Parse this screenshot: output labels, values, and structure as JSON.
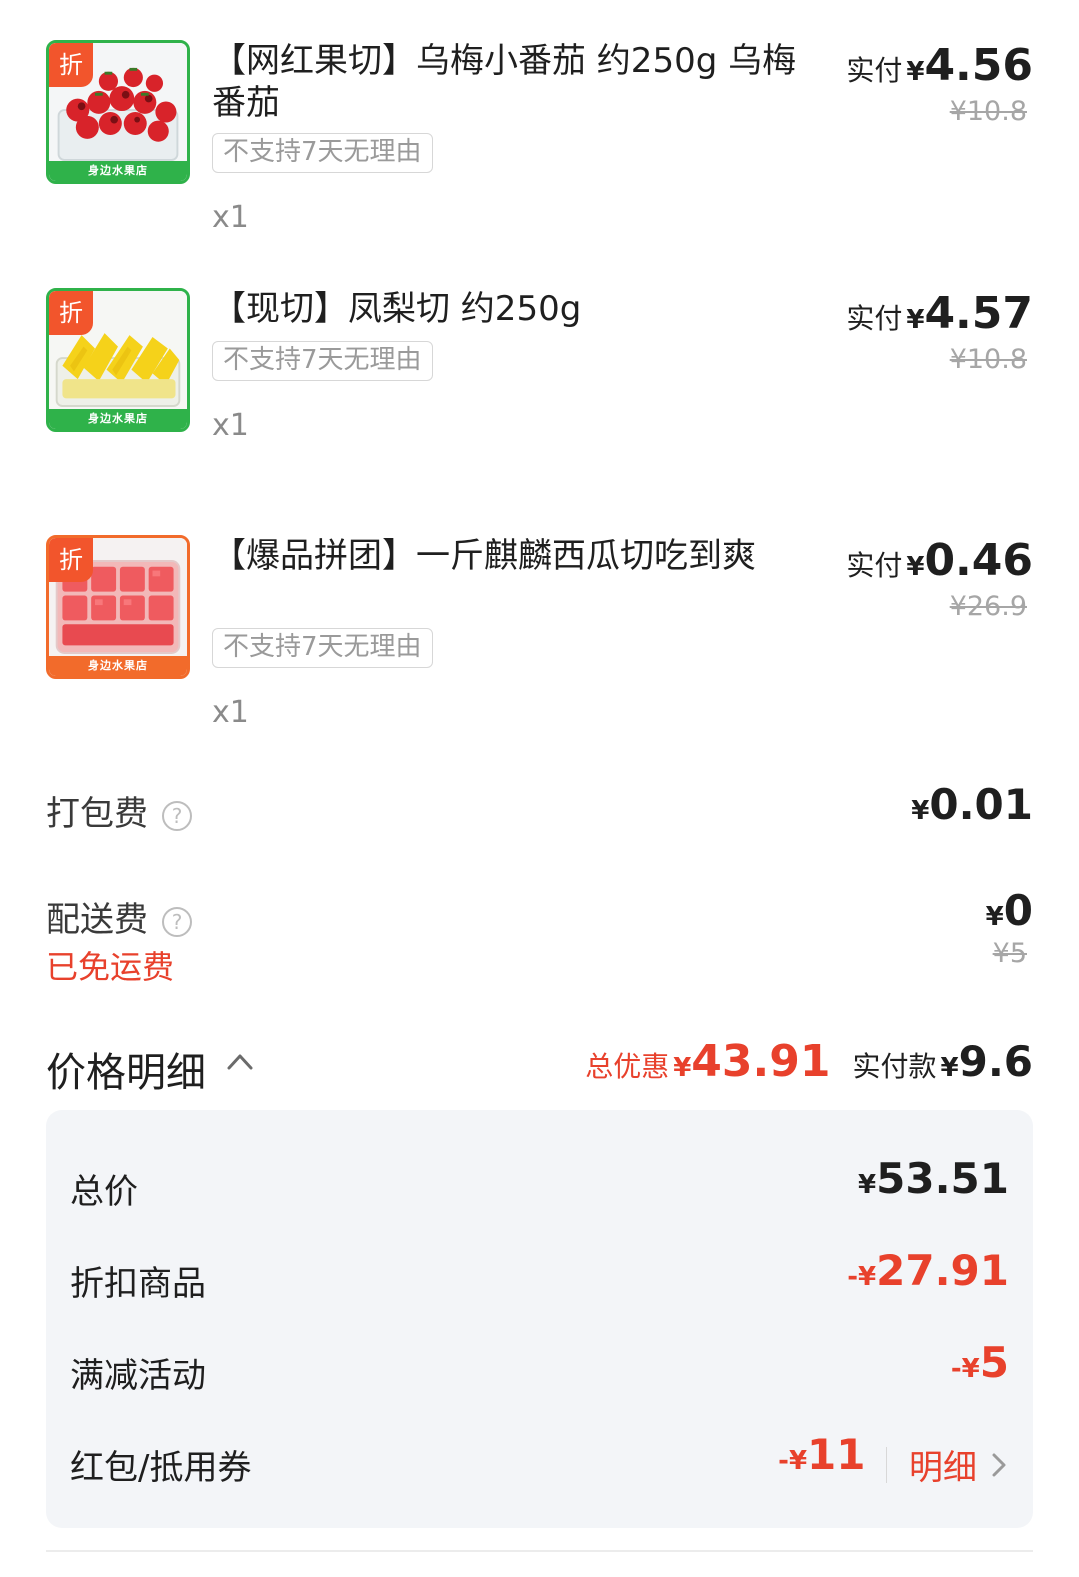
{
  "items": [
    {
      "badge": "折",
      "shop_band": "身边水果店",
      "title": "【网红果切】乌梅小番茄 约250g 乌梅番茄",
      "tag": "不支持7天无理由",
      "qty": "x1",
      "paid_label": "实付",
      "yen": "¥",
      "paid": "4.56",
      "original": "¥10.8",
      "image": "cherry-tomato-photo",
      "border_color": "#2fb24a"
    },
    {
      "badge": "折",
      "shop_band": "身边水果店",
      "title": "【现切】凤梨切 约250g",
      "tag": "不支持7天无理由",
      "qty": "x1",
      "paid_label": "实付",
      "yen": "¥",
      "paid": "4.57",
      "original": "¥10.8",
      "image": "pineapple-photo",
      "border_color": "#2fb24a"
    },
    {
      "badge": "折",
      "shop_band": "身边水果店",
      "title": "【爆品拼团】一斤麒麟西瓜切吃到爽",
      "tag": "不支持7天无理由",
      "qty": "x1",
      "paid_label": "实付",
      "yen": "¥",
      "paid": "0.46",
      "original": "¥26.9",
      "image": "watermelon-photo",
      "border_color": "#f26b2b"
    }
  ],
  "packing_fee": {
    "label": "打包费",
    "help_icon": "question-circle-icon",
    "yen": "¥",
    "amount": "0.01"
  },
  "delivery_fee": {
    "label": "配送费",
    "help_icon": "question-circle-icon",
    "note": "已免运费",
    "yen": "¥",
    "amount": "0",
    "original": "¥5"
  },
  "price_detail": {
    "title": "价格明细",
    "toggle_icon": "chevron-up-icon",
    "discount_label": "总优惠",
    "discount_yen": "¥",
    "discount_amount": "43.91",
    "paid_label": "实付款",
    "paid_yen": "¥",
    "paid_amount": "9.6",
    "rows": [
      {
        "label": "总价",
        "sign": "",
        "yen": "¥",
        "amount": "53.51",
        "tone": "black"
      },
      {
        "label": "折扣商品",
        "sign": "-",
        "yen": "¥",
        "amount": "27.91",
        "tone": "red"
      },
      {
        "label": "满减活动",
        "sign": "-",
        "yen": "¥",
        "amount": "5",
        "tone": "red"
      },
      {
        "label": "红包/抵用券",
        "sign": "-",
        "yen": "¥",
        "amount": "11",
        "tone": "red",
        "link": "明细",
        "link_icon": "chevron-right-icon"
      }
    ]
  },
  "colors": {
    "accent_red": "#e8412c",
    "badge_orange": "#f2552c",
    "green_border": "#2fb24a",
    "orange_border": "#f26b2b",
    "panel_bg": "#f3f5f8"
  }
}
